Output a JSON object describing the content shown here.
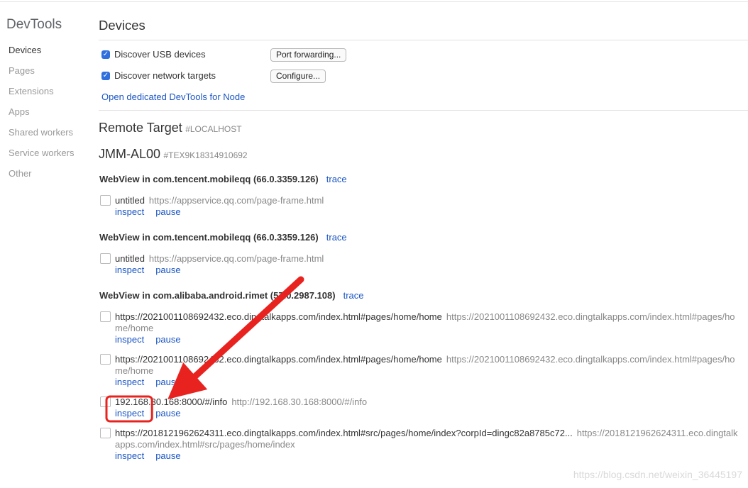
{
  "sidebar": {
    "title": "DevTools",
    "items": [
      {
        "label": "Devices"
      },
      {
        "label": "Pages"
      },
      {
        "label": "Extensions"
      },
      {
        "label": "Apps"
      },
      {
        "label": "Shared workers"
      },
      {
        "label": "Service workers"
      },
      {
        "label": "Other"
      }
    ]
  },
  "devices": {
    "title": "Devices",
    "usb": {
      "label": "Discover USB devices",
      "checked": true,
      "button": "Port forwarding..."
    },
    "network": {
      "label": "Discover network targets",
      "checked": true,
      "button": "Configure..."
    },
    "node_link": "Open dedicated DevTools for Node"
  },
  "remote": {
    "title": "Remote Target",
    "host": "#LOCALHOST"
  },
  "device": {
    "name": "JMM-AL00",
    "serial": "#TEX9K18314910692"
  },
  "webviews": [
    {
      "title": "WebView in com.tencent.mobileqq (66.0.3359.126)",
      "trace": "trace",
      "targets": [
        {
          "name": "untitled",
          "url": "https://appservice.qq.com/page-frame.html",
          "inspect": "inspect",
          "pause": "pause"
        }
      ]
    },
    {
      "title": "WebView in com.tencent.mobileqq (66.0.3359.126)",
      "trace": "trace",
      "targets": [
        {
          "name": "untitled",
          "url": "https://appservice.qq.com/page-frame.html",
          "inspect": "inspect",
          "pause": "pause"
        }
      ]
    },
    {
      "title": "WebView in com.alibaba.android.rimet (57.0.2987.108)",
      "trace": "trace",
      "targets": [
        {
          "name": "https://2021001108692432.eco.dingtalkapps.com/index.html#pages/home/home",
          "url": "https://2021001108692432.eco.dingtalkapps.com/index.html#pages/home/home",
          "inspect": "inspect",
          "pause": "pause"
        },
        {
          "name": "https://2021001108692432.eco.dingtalkapps.com/index.html#pages/home/home",
          "url": "https://2021001108692432.eco.dingtalkapps.com/index.html#pages/home/home",
          "inspect": "inspect",
          "pause": "pause"
        },
        {
          "name": "192.168.30.168:8000/#/info",
          "url": "http://192.168.30.168:8000/#/info",
          "inspect": "inspect",
          "pause": "pause"
        },
        {
          "name": "https://2018121962624311.eco.dingtalkapps.com/index.html#src/pages/home/index?corpId=dingc82a8785c72...",
          "url": "https://2018121962624311.eco.dingtalkapps.com/index.html#src/pages/home/index",
          "inspect": "inspect",
          "pause": "pause"
        }
      ]
    }
  ],
  "annotation": {
    "color": "#e8231f"
  },
  "watermark": "https://blog.csdn.net/weixin_36445197"
}
